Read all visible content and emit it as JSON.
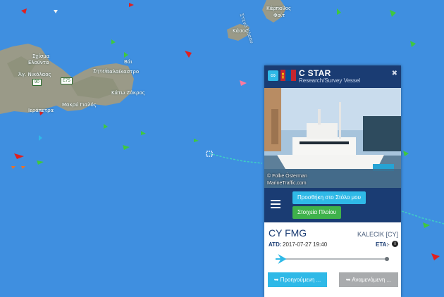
{
  "map": {
    "labels": {
      "karpathos": "Κάρπαθος",
      "karpathos_sub": "Φοίτ",
      "kasos": "Κάσος",
      "strait": "Στενό Κάσου",
      "sitia": "Σητεία",
      "palekastro": "Παλαίκαστρο",
      "agios_nikolaos": "Άγ. Νικόλαος",
      "elounta": "Ελούντα",
      "ierapetra": "Ιεράπετρα",
      "makrigialos": "Μακρύ Γιαλός",
      "kato_zakros": "Κάτω Ζάκρος",
      "voi": "Βάι",
      "sitia_town": "Σχίσμα"
    },
    "roads": {
      "r90": "90",
      "r43": "E75"
    }
  },
  "vessel": {
    "name": "C STAR",
    "type": "Research/Survey Vessel",
    "photo_credit_1": "© Folke Österman",
    "photo_credit_2": "MarineTraffic.com",
    "add_fleet": "Προσθήκη στο Στόλο μου",
    "details": "Στοιχεία Πλοίου",
    "from": "CY FMG",
    "to": "KALECIK [CY]",
    "atd_label": "ATD:",
    "atd_value": "2017-07-27 19:40",
    "eta_label": "ETA:",
    "eta_value": "-",
    "progress": 0.06,
    "prev_btn": "Προηγούμενη ...",
    "next_btn": "Αναμενόμενη ..."
  },
  "colors": {
    "sea": "#3f8fe0",
    "panel_header": "#1a3c73",
    "accent": "#2fb9e7",
    "green": "#3fb24b"
  }
}
